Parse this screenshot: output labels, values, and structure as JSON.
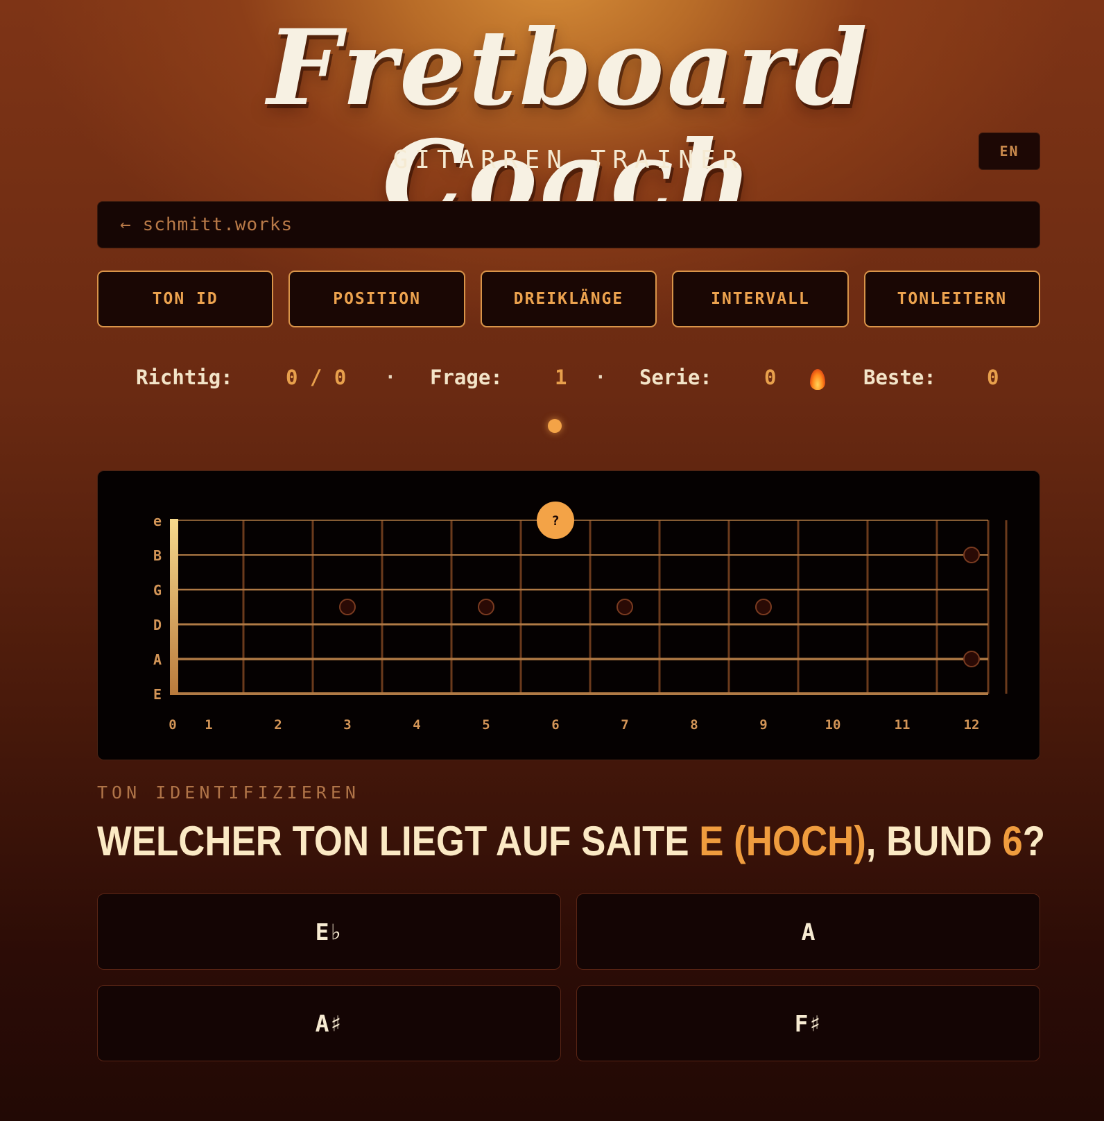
{
  "app": {
    "title": "Fretboard Coach",
    "subtitle": "GITARREN TRAINER",
    "lang_button": "EN",
    "back_arrow": "←",
    "back_link": "schmitt.works"
  },
  "tabs": [
    {
      "label": "TON ID"
    },
    {
      "label": "POSITION"
    },
    {
      "label": "DREIKLÄNGE"
    },
    {
      "label": "INTERVALL"
    },
    {
      "label": "TONLEITERN"
    }
  ],
  "stats": {
    "correct_label": "Richtig:",
    "correct_value": "0 / 0",
    "separator": "·",
    "question_label": "Frage:",
    "question_value": "1",
    "streak_label": "Serie:",
    "streak_value": "0",
    "streak_icon": "flame-icon",
    "best_label": "Beste:",
    "best_value": "0"
  },
  "fretboard": {
    "strings": [
      "e",
      "B",
      "G",
      "D",
      "A",
      "E"
    ],
    "fret_numbers": [
      "0",
      "1",
      "2",
      "3",
      "4",
      "5",
      "6",
      "7",
      "8",
      "9",
      "10",
      "11",
      "12"
    ],
    "inlay_frets": [
      3,
      5,
      7,
      9
    ],
    "double_inlay_fret": 12,
    "marker": {
      "string": "e",
      "fret": 6,
      "label": "?"
    },
    "colors": {
      "accent": "#f3a347",
      "string": "#b07a45",
      "fret": "#6b3a1c",
      "nut": "#e9b96a",
      "label": "#d39557"
    }
  },
  "question": {
    "section_label": "TON IDENTIFIZIEREN",
    "prefix": "WELCHER TON LIEGT AUF SAITE ",
    "string_name": "E (HOCH)",
    "middle": ", BUND ",
    "fret": "6",
    "suffix": "?"
  },
  "answers": [
    {
      "label": "E♭"
    },
    {
      "label": "A"
    },
    {
      "label": "A♯"
    },
    {
      "label": "F♯"
    }
  ]
}
